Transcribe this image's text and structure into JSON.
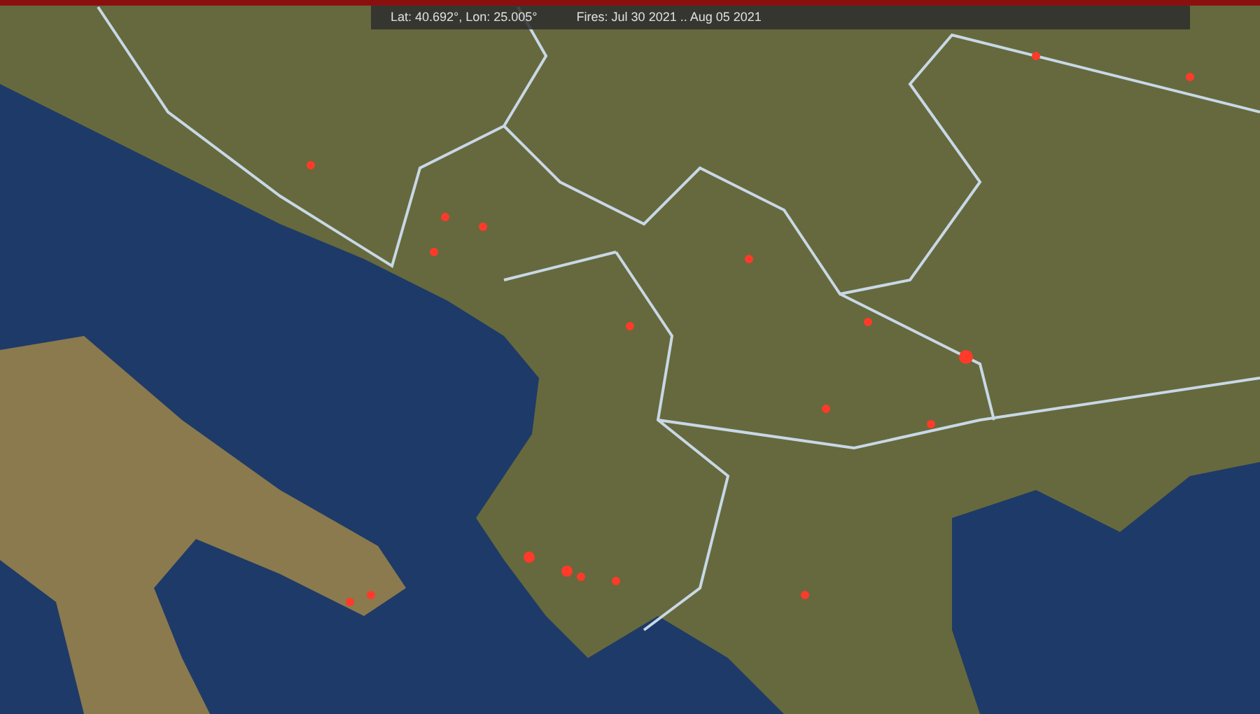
{
  "status_bar": {
    "coordinates": "Lat: 40.692°, Lon: 25.005°",
    "fire_dates": "Fires: Jul 30 2021 .. Aug 05 2021"
  }
}
